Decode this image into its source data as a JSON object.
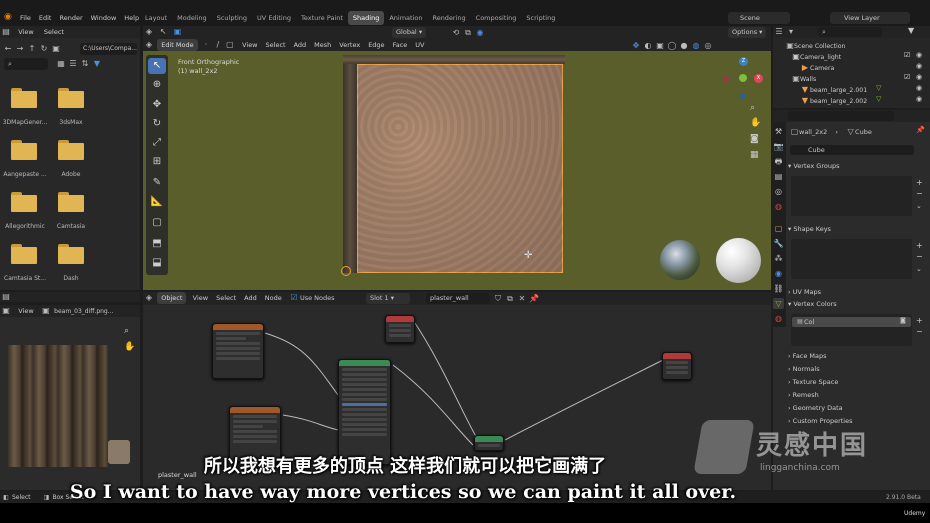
{
  "topbar": {
    "menus": [
      "File",
      "Edit",
      "Render",
      "Window",
      "Help"
    ],
    "workspaces": [
      "Layout",
      "Modeling",
      "Sculpting",
      "UV Editing",
      "Texture Paint",
      "Shading",
      "Animation",
      "Rendering",
      "Compositing",
      "Scripting"
    ],
    "active_workspace": "Shading",
    "scene": "Scene",
    "view_layer": "View Layer"
  },
  "file_browser": {
    "menus": [
      "View",
      "Select"
    ],
    "path": "C:\\Users\\Compa...",
    "folders": [
      "3DMapGener...",
      "3dsMax",
      "Aangepaste ...",
      "Adobe",
      "Allegorithmic",
      "Camtasia",
      "Camtasia St...",
      "Dash"
    ]
  },
  "viewport": {
    "mode": "Edit Mode",
    "menus": [
      "View",
      "Select",
      "Add",
      "Mesh",
      "Vertex",
      "Edge",
      "Face",
      "UV"
    ],
    "orientation": "Global",
    "options": "Options",
    "view_name": "Front Orthographic",
    "object_name": "(1) wall_2x2"
  },
  "image_editor": {
    "menu": "View",
    "image_name": "beam_03_diff.png..."
  },
  "node_editor": {
    "object": "Object",
    "menus": [
      "View",
      "Select",
      "Add",
      "Node"
    ],
    "use_nodes": "Use Nodes",
    "slot": "Slot 1",
    "material": "plaster_wall",
    "frame_label": "plaster_wall"
  },
  "outliner": {
    "items": [
      {
        "label": "Scene Collection",
        "indent": 0
      },
      {
        "label": "Camera_light",
        "indent": 1
      },
      {
        "label": "Camera",
        "indent": 2
      },
      {
        "label": "Walls",
        "indent": 1
      },
      {
        "label": "beam_large_2.001",
        "indent": 2
      },
      {
        "label": "beam_large_2.002",
        "indent": 2
      }
    ]
  },
  "properties": {
    "object": "wall_2x2",
    "mesh": "Cube",
    "data_name": "Cube",
    "sections": [
      "Vertex Groups",
      "Shape Keys",
      "UV Maps",
      "Vertex Colors"
    ],
    "vertex_color_item": "Col",
    "collapsed_sections": [
      "Face Maps",
      "Normals",
      "Texture Space",
      "Remesh",
      "Geometry Data",
      "Custom Properties"
    ]
  },
  "statusbar": {
    "select": "Select",
    "box_select": "Box Select",
    "version": "2.91.0 Beta"
  },
  "subtitles": {
    "chinese": "所以我想有更多的顶点 这样我们就可以把它画满了",
    "english": "So I want to have way more vertices so we can paint it all over."
  },
  "watermark": {
    "brand": "灵感中国",
    "url": "lingganchina.com",
    "udemy": "Udemy"
  }
}
